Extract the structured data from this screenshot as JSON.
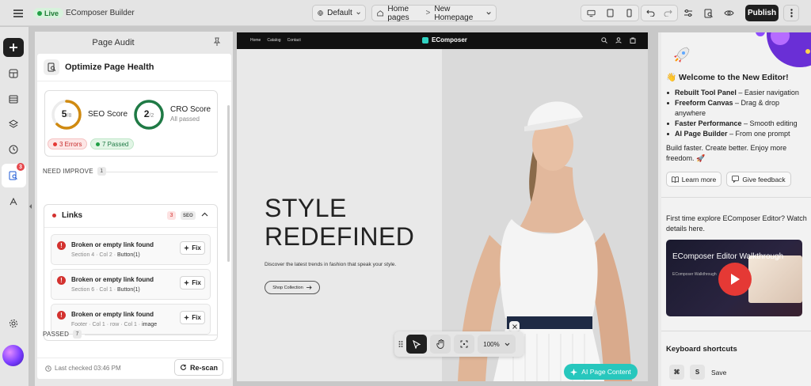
{
  "topbar": {
    "status": "Live",
    "app_name": "EComposer Builder",
    "market": "Default",
    "breadcrumb_parent": "Home pages",
    "breadcrumb_current": "New Homepage",
    "publish_label": "Publish"
  },
  "rail": {
    "audit_badge": "3"
  },
  "audit": {
    "panel_title": "Page Audit",
    "card_title": "Optimize Page Health",
    "seo": {
      "score": "5",
      "total": "/8",
      "label": "SEO Score",
      "fraction": 0.625
    },
    "cro": {
      "score": "2",
      "total": "/2",
      "label": "CRO Score",
      "sub": "All passed",
      "fraction": 1.0
    },
    "errors_chip": "3 Errors",
    "passed_chip": "7 Passed",
    "need_improve": {
      "label": "NEED IMPROVE",
      "count": "1"
    },
    "links": {
      "title": "Links",
      "count": "3",
      "tag": "SEO"
    },
    "issues": [
      {
        "title": "Broken or empty link found",
        "path": "Section 4 · Col 2 · ",
        "target": "Button(1)",
        "fix": "Fix"
      },
      {
        "title": "Broken or empty link found",
        "path": "Section 6 · Col 1 · ",
        "target": "Button(1)",
        "fix": "Fix"
      },
      {
        "title": "Broken or empty link found",
        "path": "Footer · Col 1 · row · Col 1 · ",
        "target": "image",
        "fix": "Fix"
      }
    ],
    "passed": {
      "label": "PASSED",
      "count": "7"
    },
    "last_checked": "Last checked 03:46 PM",
    "rescan": "Re-scan"
  },
  "canvas": {
    "nav": [
      "Home",
      "Catalog",
      "Contact"
    ],
    "logo": "EComposer",
    "hero_line1": "STYLE",
    "hero_line2": "REDEFINED",
    "hero_sub": "Discover the latest trends in fashion that speak your style.",
    "hero_btn": "Shop Collection",
    "zoom": "100%",
    "ai_button": "AI Page Content"
  },
  "right": {
    "welcome": "👋 Welcome to the New Editor!",
    "features": [
      {
        "bold": "Rebuilt Tool Panel",
        "rest": " – Easier navigation"
      },
      {
        "bold": "Freeform Canvas",
        "rest": " – Drag & drop anywhere"
      },
      {
        "bold": "Faster Performance",
        "rest": " – Smooth editing"
      },
      {
        "bold": "AI Page Builder",
        "rest": " – From one prompt"
      }
    ],
    "tagline": "Build faster. Create better. Enjoy more freedom. 🚀",
    "learn_more": "Learn more",
    "feedback": "Give feedback",
    "first_time": "First time explore EComposer Editor? Watch details here.",
    "video_title": "EComposer Editor Walkthrough",
    "video_sub": "EComposer Walkthrough",
    "shortcuts_title": "Keyboard shortcuts",
    "key1": "⌘",
    "key2": "S",
    "save_label": "Save"
  }
}
